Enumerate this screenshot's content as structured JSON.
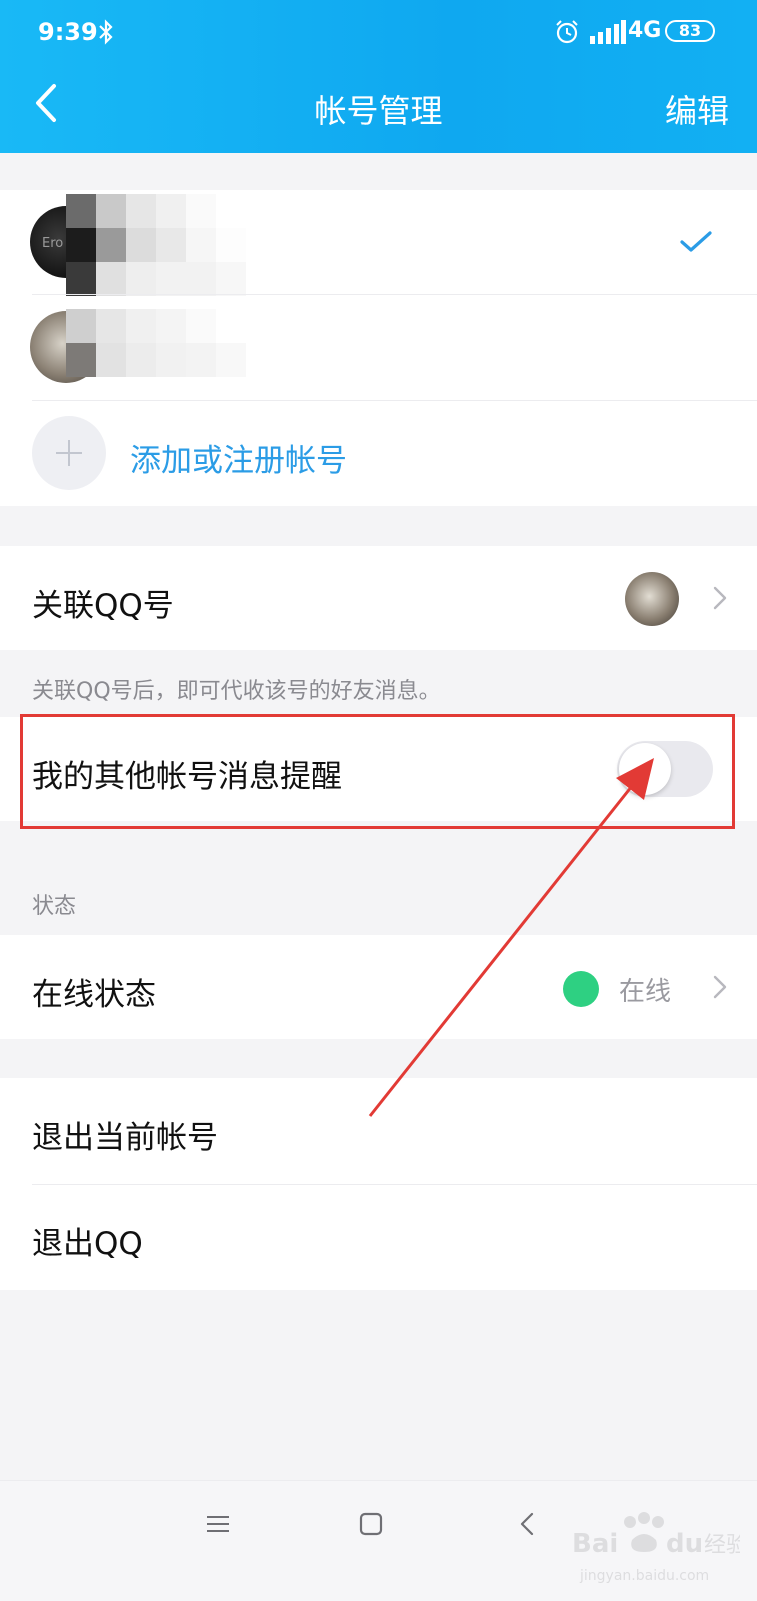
{
  "status_bar": {
    "time": "9:39",
    "network": "4G",
    "battery": "83",
    "icons": [
      "bluetooth-icon",
      "alarm-icon",
      "signal-icon"
    ]
  },
  "header": {
    "title": "帐号管理",
    "edit_label": "编辑",
    "back_icon": "chevron-left-icon"
  },
  "accounts": {
    "items": [
      {
        "selected": true
      },
      {
        "selected": false
      }
    ],
    "avatar1_text": "Ero",
    "add_label": "添加或注册帐号"
  },
  "link_qq": {
    "label": "关联QQ号",
    "hint": "关联QQ号后，即可代收该号的好友消息。"
  },
  "other_accounts": {
    "label": "我的其他帐号消息提醒",
    "toggle_on": false
  },
  "status_section": {
    "header": "状态",
    "online_label": "在线状态",
    "online_value": "在线"
  },
  "logout": {
    "current_label": "退出当前帐号",
    "qq_label": "退出QQ"
  },
  "colors": {
    "header": "#12b0f3",
    "link": "#2b9ce6",
    "online": "#2ed082",
    "highlight": "#e23a35"
  },
  "watermark": {
    "text": "Bai du 经验",
    "url": "jingyan.baidu.com"
  }
}
